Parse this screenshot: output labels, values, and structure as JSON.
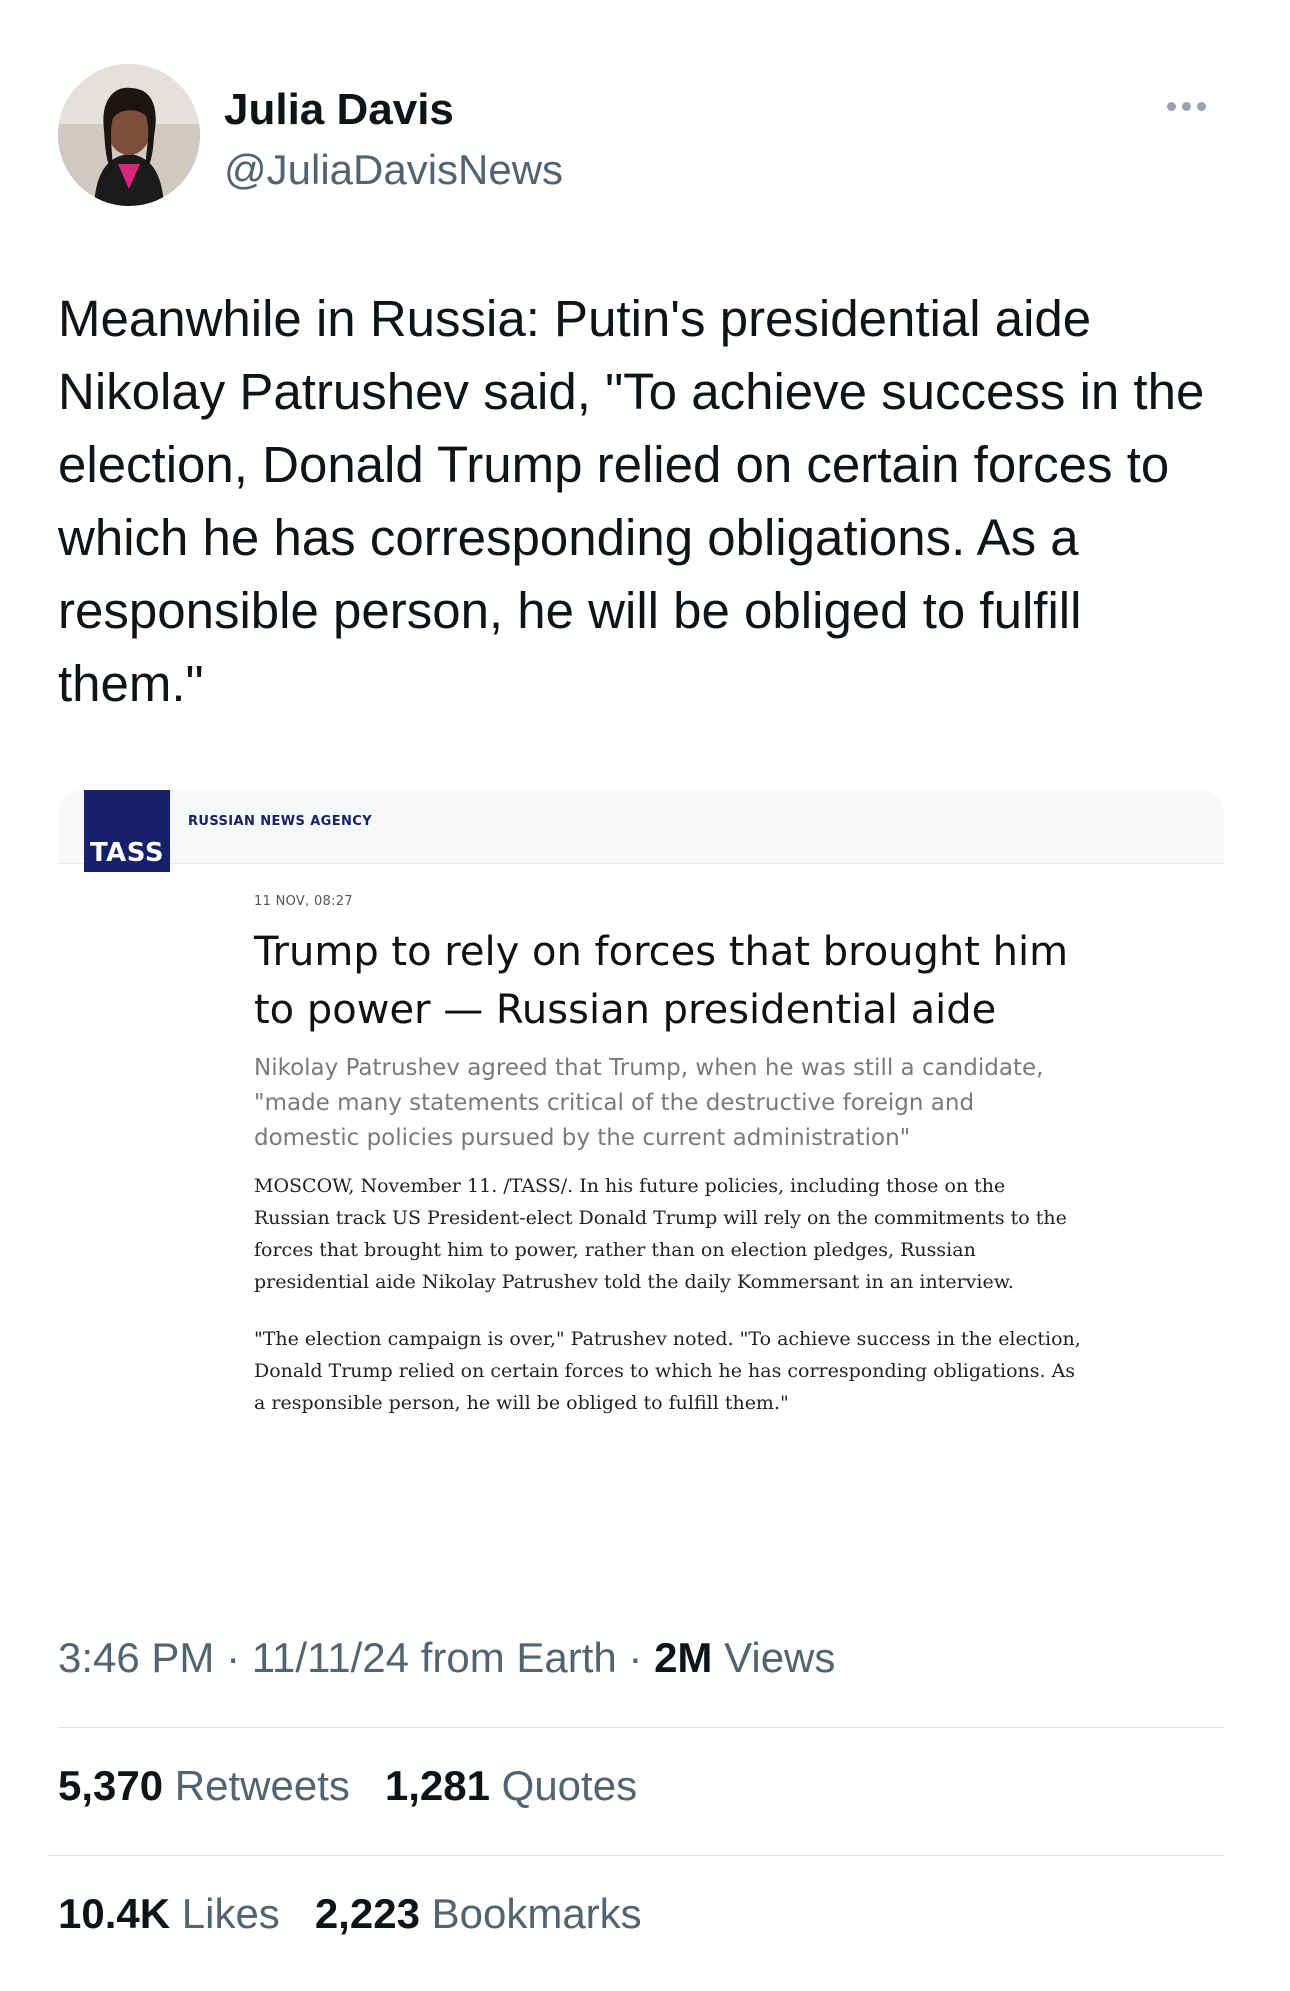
{
  "author": {
    "name": "Julia Davis",
    "handle": "@JuliaDavisNews"
  },
  "tweet": {
    "text": "Meanwhile in Russia: Putin's presidential aide Nikolay Patrushev said, \"To achieve success in the election, Donald Trump relied on certain forces to which he has corresponding obligations. As a responsible person, he will be obliged to fulfill them.\""
  },
  "card": {
    "logo": "TASS",
    "agency": "RUSSIAN NEWS AGENCY",
    "date": "11 NOV, 08:27",
    "title": "Trump to rely on forces that brought him to power — Russian presidential aide",
    "lead": "Nikolay Patrushev agreed that Trump, when he was still a candidate, \"made many statements critical of the destructive foreign and domestic policies pursued by the current administration\"",
    "body": [
      "MOSCOW, November 11. /TASS/. In his future policies, including those on the Russian track US President-elect Donald Trump will rely on the commitments to the forces that brought him to power, rather than on election pledges, Russian presidential aide Nikolay Patrushev told the daily Kommersant in an interview.",
      "\"The election campaign is over,\" Patrushev noted. \"To achieve success in the election, Donald Trump relied on certain forces to which he has corresponding obligations. As a responsible person, he will be obliged to fulfill them.\""
    ]
  },
  "meta": {
    "time": "3:46 PM",
    "date": "11/11/24",
    "source": "from Earth",
    "views_count": "2M",
    "views_label": "Views"
  },
  "stats": {
    "retweets_count": "5,370",
    "retweets_label": "Retweets",
    "quotes_count": "1,281",
    "quotes_label": "Quotes",
    "likes_count": "10.4K",
    "likes_label": "Likes",
    "bookmarks_count": "2,223",
    "bookmarks_label": "Bookmarks"
  },
  "icons": {
    "more": "more-options-icon"
  }
}
